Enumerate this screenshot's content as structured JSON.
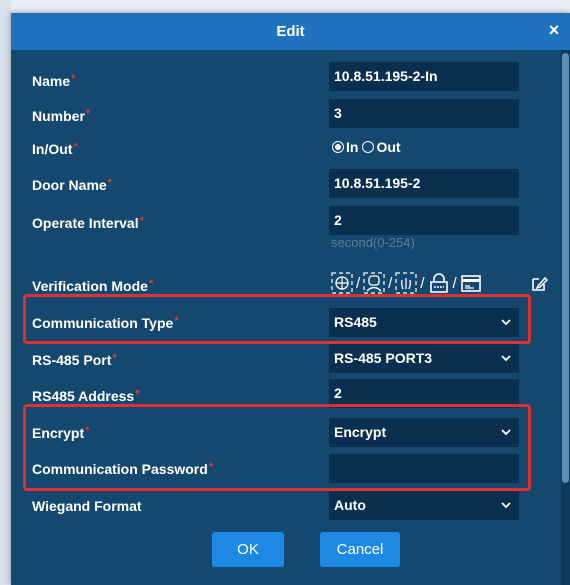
{
  "dialog": {
    "title": "Edit",
    "close_label": "×"
  },
  "required_mark": "*",
  "fields": {
    "name": {
      "label": "Name",
      "value": "10.8.51.195-2-In"
    },
    "number": {
      "label": "Number",
      "value": "3"
    },
    "inout": {
      "label": "In/Out",
      "options": [
        "In",
        "Out"
      ],
      "selected": "In"
    },
    "door_name": {
      "label": "Door Name",
      "value": "10.8.51.195-2"
    },
    "operate_interval": {
      "label": "Operate Interval",
      "value": "2",
      "hint": "second(0-254)"
    },
    "verification_mode": {
      "label": "Verification Mode",
      "icons": [
        "fingerprint-icon",
        "face-icon",
        "palm-icon",
        "password-lock-icon",
        "card-icon"
      ]
    },
    "communication_type": {
      "label": "Communication Type",
      "value": "RS485"
    },
    "rs485_port": {
      "label": "RS-485 Port",
      "value": "RS-485 PORT3"
    },
    "rs485_address": {
      "label": "RS485 Address",
      "value": "2"
    },
    "encrypt": {
      "label": "Encrypt",
      "value": "Encrypt"
    },
    "comm_password": {
      "label": "Communication Password",
      "value": ""
    },
    "wiegand_format": {
      "label": "Wiegand Format",
      "value": "Auto"
    }
  },
  "buttons": {
    "ok": "OK",
    "cancel": "Cancel"
  },
  "colors": {
    "dialog_bg": "#15486f",
    "titlebar": "#1f72bd",
    "field_bg": "#0b2f4f",
    "button": "#1e88e5",
    "highlight": "#e03030",
    "required": "#e53935"
  }
}
